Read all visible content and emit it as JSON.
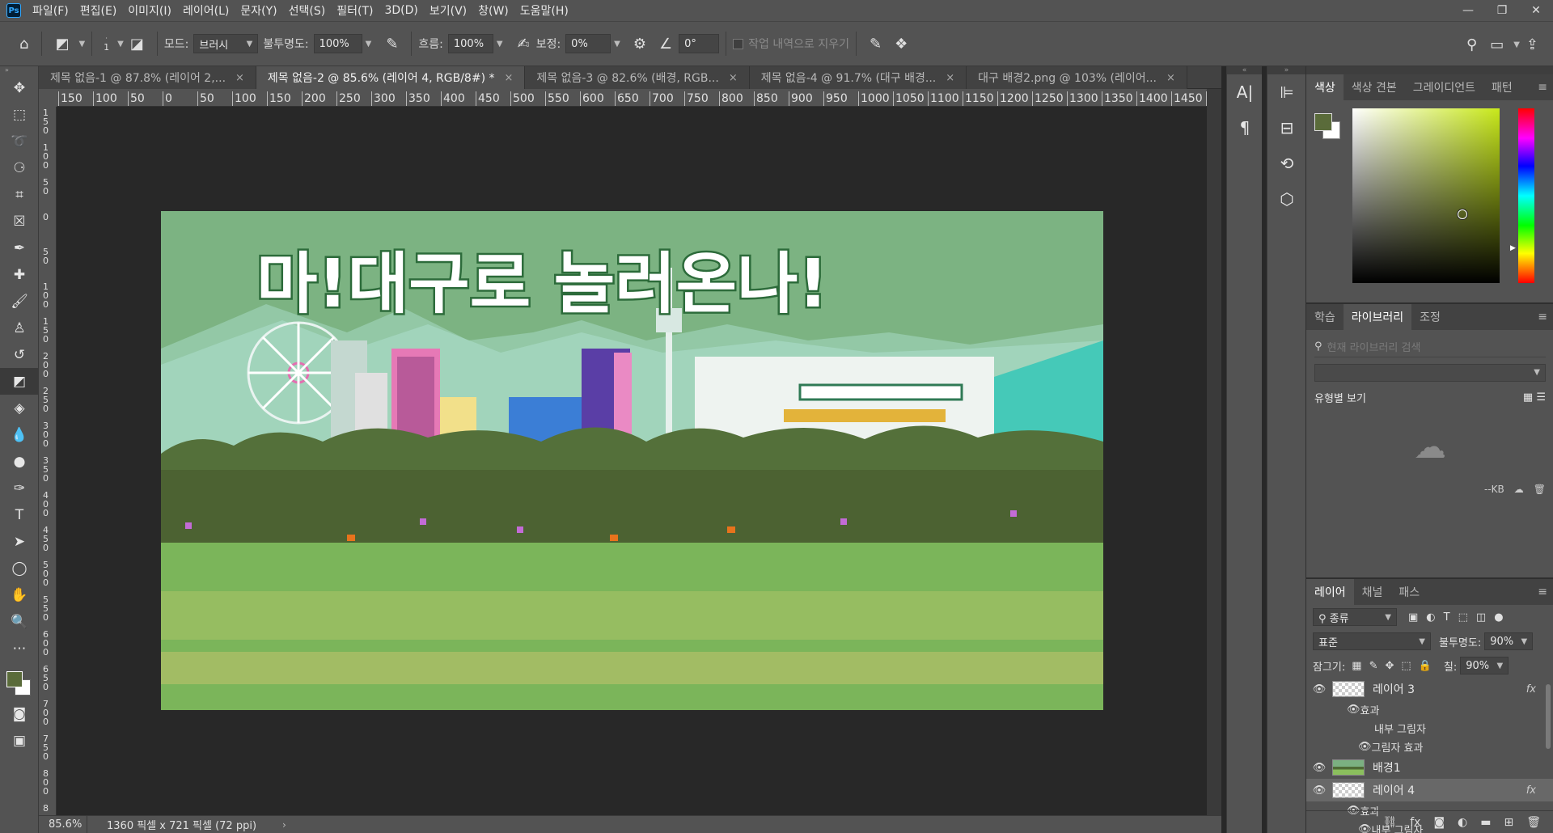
{
  "app": {
    "logo": "Ps"
  },
  "menu": [
    "파일(F)",
    "편집(E)",
    "이미지(I)",
    "레이어(L)",
    "문자(Y)",
    "선택(S)",
    "필터(T)",
    "3D(D)",
    "보기(V)",
    "창(W)",
    "도움말(H)"
  ],
  "window_controls": {
    "minimize": "—",
    "restore": "❐",
    "close": "✕"
  },
  "options": {
    "brush_size": "1",
    "mode_label": "모드:",
    "mode_value": "브러시",
    "opacity_label": "불투명도:",
    "opacity_value": "100%",
    "flow_label": "흐름:",
    "flow_value": "100%",
    "smoothing_label": "보정:",
    "smoothing_value": "0%",
    "angle_value": "0°",
    "erase_history_label": "작업 내역으로 지우기"
  },
  "tabs": [
    {
      "label": "제목 없음-1 @ 87.8% (레이어 2,...",
      "close": "×"
    },
    {
      "label": "제목 없음-2 @ 85.6% (레이어 4, RGB/8#) *",
      "close": "×"
    },
    {
      "label": "제목 없음-3 @ 82.6% (배경, RGB...",
      "close": "×"
    },
    {
      "label": "제목 없음-4 @ 91.7% (대구 배경...",
      "close": "×"
    },
    {
      "label": "대구 배경2.png @ 103% (레이어...",
      "close": "×"
    }
  ],
  "ruler_h": [
    "150",
    "100",
    "50",
    "0",
    "50",
    "100",
    "150",
    "200",
    "250",
    "300",
    "350",
    "400",
    "450",
    "500",
    "550",
    "600",
    "650",
    "700",
    "750",
    "800",
    "850",
    "900",
    "950",
    "1000",
    "1050",
    "1100",
    "1150",
    "1200",
    "1250",
    "1300",
    "1350",
    "1400",
    "1450",
    "1"
  ],
  "ruler_v": [
    "150",
    "100",
    "50",
    "0",
    "50",
    "100",
    "150",
    "200",
    "250",
    "300",
    "350",
    "400",
    "450",
    "500",
    "550",
    "600",
    "650",
    "700",
    "750",
    "800",
    "8"
  ],
  "artwork": {
    "headline": "마!대구로 놀러온나!"
  },
  "status": {
    "zoom": "85.6%",
    "doc_info": "1360 픽셀 x 721 픽셀 (72 ppi)",
    "arrow": "›"
  },
  "color_panel": {
    "tabs": [
      "색상",
      "색상 견본",
      "그레이디언트",
      "패턴"
    ],
    "menu": "≡",
    "foreground": "#5a6b3a",
    "background": "#ffffff"
  },
  "library_panel": {
    "tabs": [
      "학습",
      "라이브러리",
      "조정"
    ],
    "menu": "≡",
    "search_placeholder": "현재 라이브러리 검색",
    "view_label": "유형별 보기",
    "size": "--KB"
  },
  "layers_panel": {
    "tabs": [
      "레이어",
      "채널",
      "패스"
    ],
    "menu": "≡",
    "filter_label": "종류",
    "blend_mode": "표준",
    "opacity_label": "불투명도:",
    "opacity_value": "90%",
    "lock_label": "잠그기:",
    "fill_label": "칠:",
    "fill_value": "90%",
    "layers": [
      {
        "name": "레이어 3",
        "fx": "fx",
        "effects_label": "효과",
        "effects": [
          "내부 그림자",
          "그림자 효과"
        ]
      },
      {
        "name": "배경1"
      },
      {
        "name": "레이어 4",
        "fx": "fx",
        "effects_label": "효과",
        "effects": [
          "내부 그림자"
        ]
      }
    ]
  }
}
